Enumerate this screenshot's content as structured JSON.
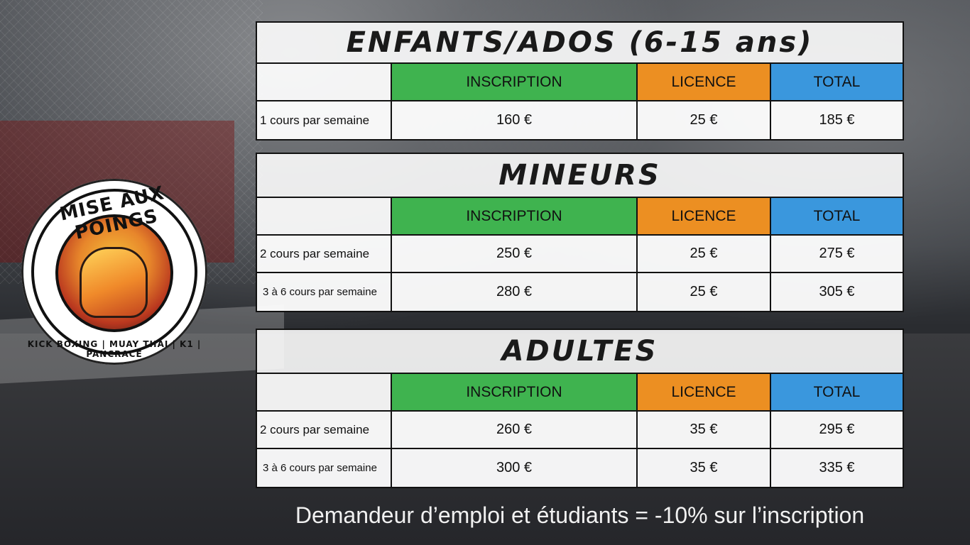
{
  "logo": {
    "title": "MISE AUX POINGS",
    "subtitle": "KICK BOXING | MUAY THAI | K1 | PANCRACE"
  },
  "columns": {
    "inscription": "INSCRIPTION",
    "licence": "LICENCE",
    "total": "TOTAL"
  },
  "sections": [
    {
      "title": "ENFANTS/ADOS (6-15 ans)",
      "rows": [
        {
          "label": "1 cours par semaine",
          "inscription": "160 €",
          "licence": "25 €",
          "total": "185 €"
        }
      ]
    },
    {
      "title": "MINEURS",
      "rows": [
        {
          "label": "2 cours par semaine",
          "inscription": "250 €",
          "licence": "25 €",
          "total": "275 €"
        },
        {
          "label": "3 à 6 cours par semaine",
          "inscription": "280 €",
          "licence": "25 €",
          "total": "305 €"
        }
      ]
    },
    {
      "title": "ADULTES",
      "rows": [
        {
          "label": "2 cours par semaine",
          "inscription": "260 €",
          "licence": "35 €",
          "total": "295 €"
        },
        {
          "label": "3 à 6 cours par semaine",
          "inscription": "300 €",
          "licence": "35 €",
          "total": "335 €"
        }
      ]
    }
  ],
  "footer": "Demandeur d’emploi et étudiants = -10% sur l’inscription",
  "colors": {
    "inscription": "#3fb34f",
    "licence": "#ec8f22",
    "total": "#3a97dd"
  }
}
